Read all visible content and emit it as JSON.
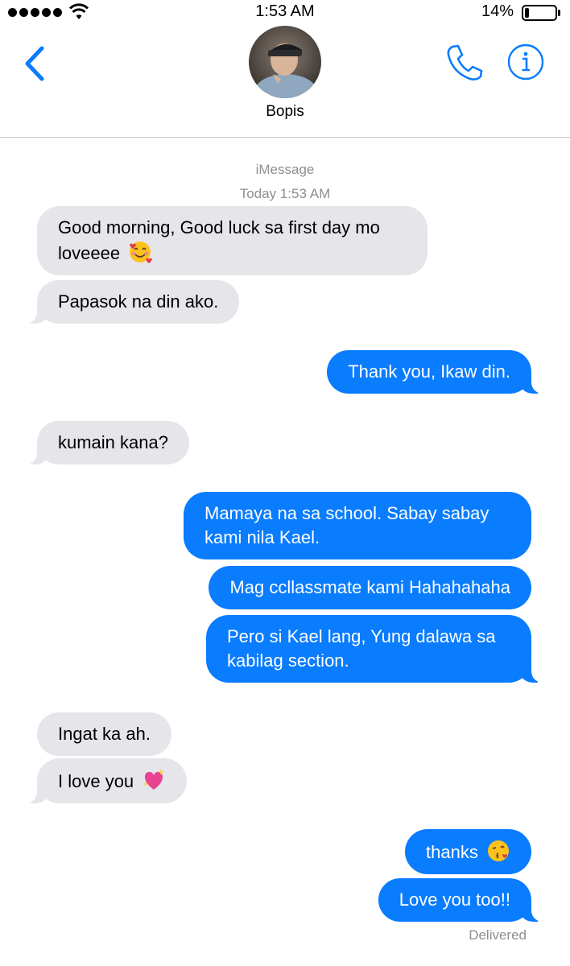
{
  "status_bar": {
    "time": "1:53 AM",
    "battery_percent_label": "14%",
    "battery_level": 0.14
  },
  "nav": {
    "contact_name": "Bopis",
    "icons": [
      "back-chevron-icon",
      "phone-icon",
      "info-icon"
    ]
  },
  "thread": {
    "service_label": "iMessage",
    "timestamp": "Today 1:53 AM",
    "messages": [
      {
        "from": "them",
        "text": "Good morning, Good luck sa first day mo loveeee",
        "emoji": "smiling-face-with-hearts"
      },
      {
        "from": "them",
        "text": "Papasok na din ako."
      },
      {
        "from": "me",
        "text": "Thank you, Ikaw din."
      },
      {
        "from": "them",
        "text": "kumain kana?"
      },
      {
        "from": "me",
        "text": "Mamaya na sa school. Sabay sabay kami nila Kael."
      },
      {
        "from": "me",
        "text": "Mag ccllassmate kami Hahahahaha"
      },
      {
        "from": "me",
        "text": "Pero si Kael lang, Yung dalawa sa kabilag section."
      },
      {
        "from": "them",
        "text": "Ingat ka ah."
      },
      {
        "from": "them",
        "text": "I love you",
        "emoji": "sparkling-heart"
      },
      {
        "from": "me",
        "text": "thanks",
        "emoji": "face-blowing-a-kiss"
      },
      {
        "from": "me",
        "text": "Love you too!!"
      }
    ],
    "delivery_status": "Delivered"
  },
  "colors": {
    "accent": "#0a7cfe",
    "incoming_bubble": "#e5e5ea",
    "secondary_text": "#8e8e93"
  }
}
